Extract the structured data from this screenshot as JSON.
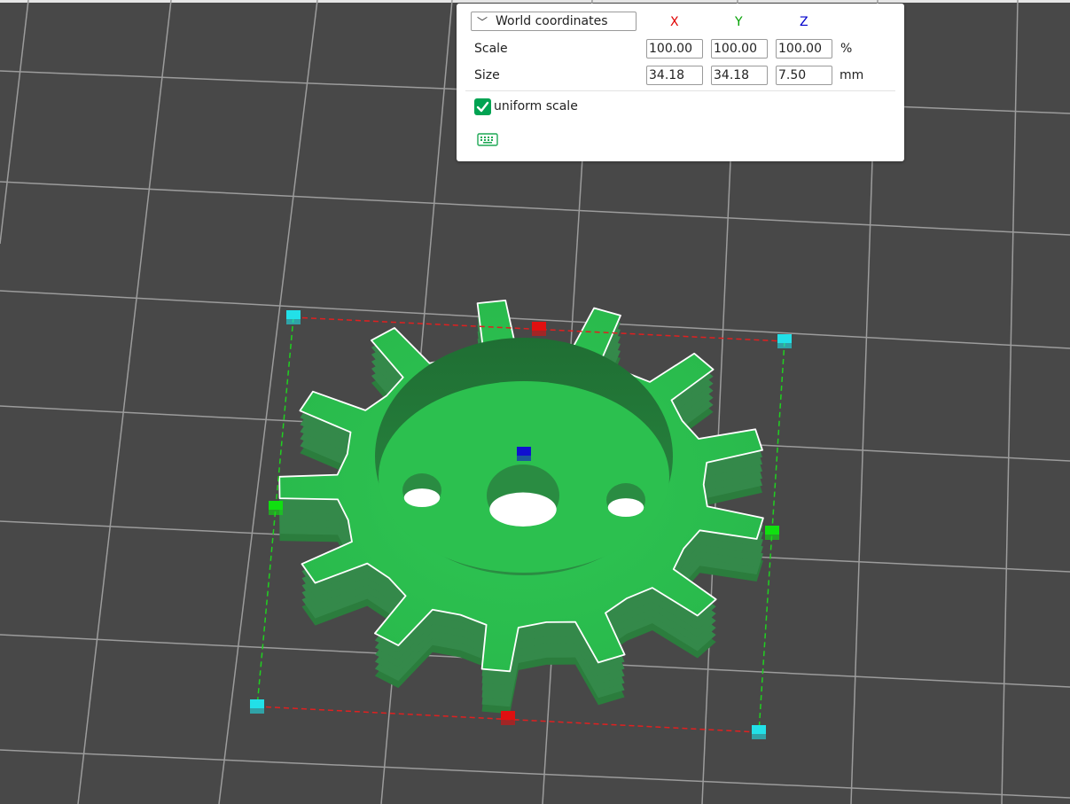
{
  "panel": {
    "coordinate_mode": "World coordinates",
    "axes": {
      "x": {
        "label": "X",
        "color": "#e00000"
      },
      "y": {
        "label": "Y",
        "color": "#00a000"
      },
      "z": {
        "label": "Z",
        "color": "#0000cc"
      }
    },
    "scale": {
      "label": "Scale",
      "x": "100.00",
      "y": "100.00",
      "z": "100.00",
      "unit": "%"
    },
    "size": {
      "label": "Size",
      "x": "34.18",
      "y": "34.18",
      "z": "7.50",
      "unit": "mm"
    },
    "uniform_scale": {
      "label": "uniform scale",
      "checked": true
    },
    "icons": {
      "dropdown": "chevron-down-icon",
      "check": "check-icon",
      "keyboard": "keyboard-icon"
    }
  },
  "viewport": {
    "object": "gear",
    "object_color": "#2cc04f",
    "background_color": "#484848",
    "grid_color": "#9a9a9a",
    "handle_colors": {
      "x": "#e01010",
      "y": "#10e010",
      "z": "#1010d0",
      "corner": "#22e0e8"
    }
  }
}
